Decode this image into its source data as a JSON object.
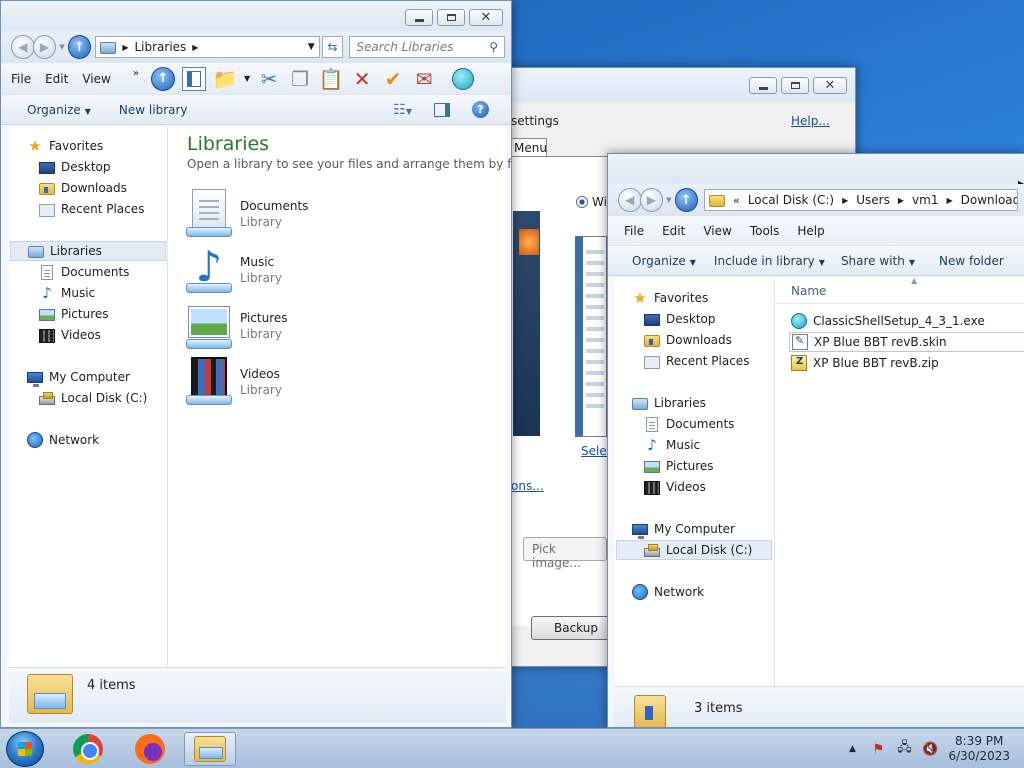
{
  "colors": {
    "library_heading": "#287a2c",
    "link": "#1a4fa5",
    "accent": "#2a67c8"
  },
  "libraries_window": {
    "address": {
      "path_label": "Libraries"
    },
    "search_placeholder": "Search Libraries",
    "menu": [
      "File",
      "Edit",
      "View"
    ],
    "commands": {
      "organize": "Organize",
      "new_library": "New library"
    },
    "nav": {
      "favorites": "Favorites",
      "desktop": "Desktop",
      "downloads": "Downloads",
      "recent": "Recent Places",
      "libraries": "Libraries",
      "documents": "Documents",
      "music": "Music",
      "pictures": "Pictures",
      "videos": "Videos",
      "computer": "My Computer",
      "local_disk": "Local Disk (C:)",
      "network": "Network"
    },
    "content": {
      "heading": "Libraries",
      "description": "Open a library to see your files and arrange them by f...",
      "items": [
        {
          "name": "Documents",
          "type": "Library",
          "icon": "documents-library-icon"
        },
        {
          "name": "Music",
          "type": "Library",
          "icon": "music-library-icon"
        },
        {
          "name": "Pictures",
          "type": "Library",
          "icon": "pictures-library-icon"
        },
        {
          "name": "Videos",
          "type": "Library",
          "icon": "videos-library-icon"
        }
      ]
    },
    "status": "4 items"
  },
  "settings_window": {
    "title_fragment": "settings",
    "help_link": "Help...",
    "tab_menu": "Menu",
    "radio_label": "Wi",
    "select_link": "Selec",
    "options_link": "ons...",
    "pick_image": "Pick image...",
    "backup_button": "Backup"
  },
  "downloads_window": {
    "breadcrumb": [
      "Local Disk (C:)",
      "Users",
      "vm1",
      "Downloads"
    ],
    "menu": [
      "File",
      "Edit",
      "View",
      "Tools",
      "Help"
    ],
    "commands": {
      "organize": "Organize",
      "include": "Include in library",
      "share": "Share with",
      "new_folder": "New folder"
    },
    "column_name": "Name",
    "nav": {
      "favorites": "Favorites",
      "desktop": "Desktop",
      "downloads": "Downloads",
      "recent": "Recent Places",
      "libraries": "Libraries",
      "documents": "Documents",
      "music": "Music",
      "pictures": "Pictures",
      "videos": "Videos",
      "computer": "My Computer",
      "local_disk": "Local Disk (C:)",
      "network": "Network"
    },
    "files": [
      {
        "name": "ClassicShellSetup_4_3_1.exe",
        "icon": "classic-shell-icon"
      },
      {
        "name": "XP Blue BBT revB.skin",
        "icon": "skin-file-icon"
      },
      {
        "name": "XP Blue BBT revB.zip",
        "icon": "zip-file-icon"
      }
    ],
    "status": "3 items"
  },
  "taskbar": {
    "time": "8:39 PM",
    "date": "6/30/2023"
  }
}
